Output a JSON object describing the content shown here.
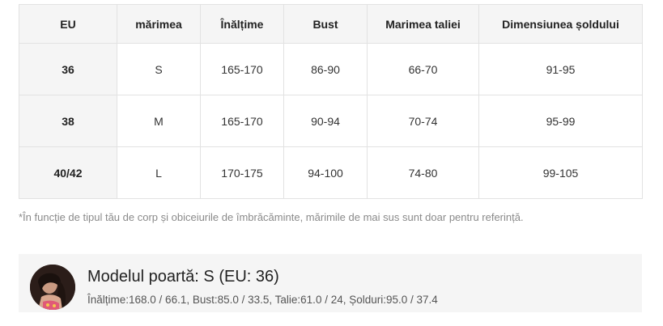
{
  "size_table": {
    "headers": [
      "EU",
      "mărimea",
      "Înălțime",
      "Bust",
      "Marimea taliei",
      "Dimensiunea șoldului"
    ],
    "rows": [
      [
        "36",
        "S",
        "165-170",
        "86-90",
        "66-70",
        "91-95"
      ],
      [
        "38",
        "M",
        "165-170",
        "90-94",
        "70-74",
        "95-99"
      ],
      [
        "40/42",
        "L",
        "170-175",
        "94-100",
        "74-80",
        "99-105"
      ]
    ]
  },
  "note": "*În funcție de tipul tău de corp și obiceiurile de îmbrăcăminte, mărimile de mai sus sunt doar pentru referință.",
  "model": {
    "title": "Modelul poartă: S (EU: 36)",
    "measurements": "Înălțime:168.0 / 66.1,  Bust:85.0 / 33.5,  Talie:61.0 / 24,  Șolduri:95.0 / 37.4"
  },
  "colors": {
    "header_bg": "#f5f5f5",
    "border": "#e2e2e2",
    "note_text": "#8a8a8a",
    "model_box_bg": "#f5f5f5"
  },
  "icons": {
    "avatar": "model-avatar-photo"
  }
}
